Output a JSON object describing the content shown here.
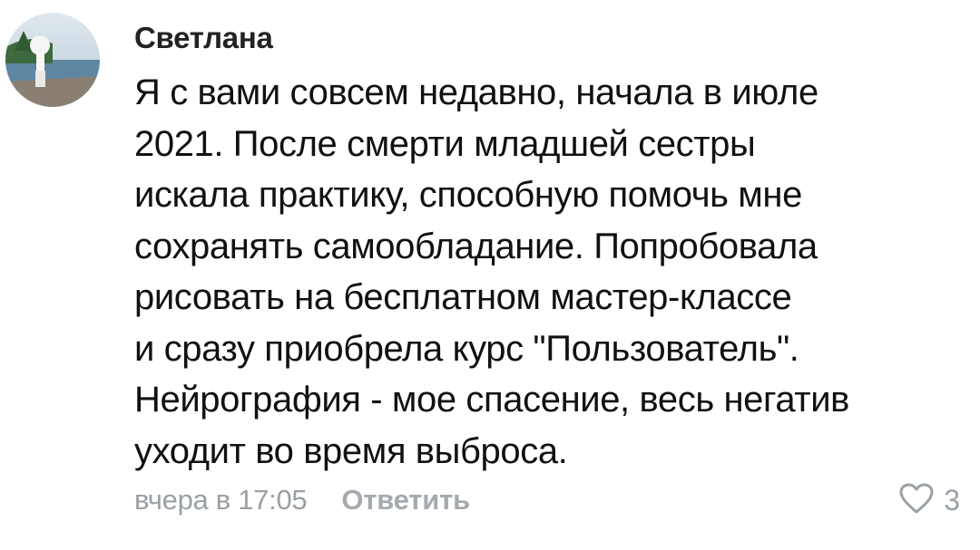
{
  "comment": {
    "author": "Светлана",
    "lines": [
      "Я с вами совсем недавно, начала в июле",
      "2021. После смерти младшей сестры",
      "искала практику, способную помочь мне",
      "сохранять самообладание. Попробовала",
      "рисовать на бесплатном мастер-классе",
      "и сразу приобрела курс \"Пользователь\".",
      "Нейрография - мое спасение, весь негатив",
      "уходит во время выброса."
    ],
    "timestamp": "вчера в 17:05",
    "reply_label": "Ответить",
    "like_count": "3",
    "icons": {
      "avatar": "avatar-photo",
      "like": "heart-outline-icon"
    },
    "colors": {
      "text": "#111111",
      "muted": "#9aa0a6"
    }
  }
}
